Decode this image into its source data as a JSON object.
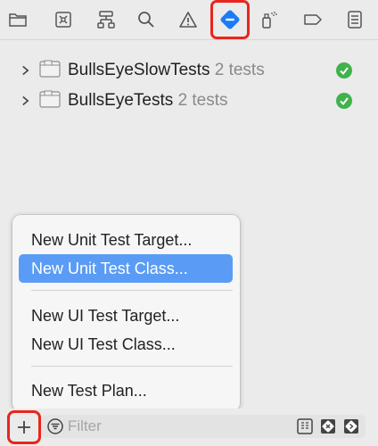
{
  "toolbar": {
    "items": [
      {
        "name": "project-navigator",
        "icon": "folder-icon"
      },
      {
        "name": "source-control-navigator",
        "icon": "source-control-icon"
      },
      {
        "name": "symbol-navigator",
        "icon": "hierarchy-icon"
      },
      {
        "name": "find-navigator",
        "icon": "search-icon"
      },
      {
        "name": "issue-navigator",
        "icon": "warning-icon"
      },
      {
        "name": "test-navigator",
        "icon": "test-diamond-icon",
        "selected": true
      },
      {
        "name": "debug-navigator",
        "icon": "spray-can-icon"
      },
      {
        "name": "breakpoint-navigator",
        "icon": "breakpoint-icon"
      },
      {
        "name": "report-navigator",
        "icon": "report-icon"
      }
    ]
  },
  "tests": [
    {
      "name": "BullsEyeSlowTests",
      "count": "2 tests",
      "status": "passed"
    },
    {
      "name": "BullsEyeTests",
      "count": "2 tests",
      "status": "passed"
    }
  ],
  "menu": {
    "items": [
      {
        "label": "New Unit Test Target..."
      },
      {
        "label": "New Unit Test Class...",
        "selected": true
      },
      {
        "label": "New UI Test Target..."
      },
      {
        "label": "New UI Test Class..."
      },
      {
        "label": "New Test Plan..."
      }
    ]
  },
  "filter": {
    "placeholder": "Filter"
  },
  "colors": {
    "accent": "#1a7cf5",
    "highlight": "#e8261d",
    "menu_selection": "#5a9cf5",
    "passed": "#3fb24a"
  }
}
